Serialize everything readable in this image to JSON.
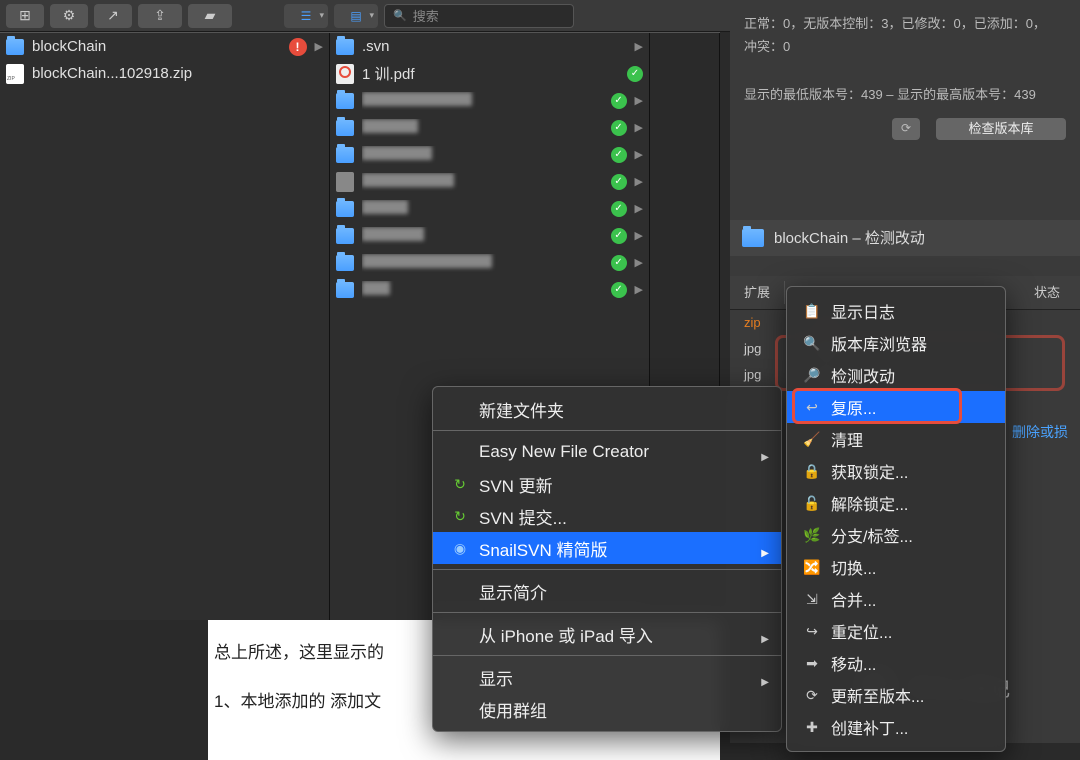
{
  "toolbar": {
    "search_placeholder": "搜索"
  },
  "col1": {
    "items": [
      {
        "type": "folder",
        "name": "blockChain",
        "alert": true,
        "chev": true
      },
      {
        "type": "zip",
        "name": "blockChain...102918.zip"
      }
    ]
  },
  "col2": {
    "items": [
      {
        "type": "folder",
        "name": ".svn",
        "chev": true
      },
      {
        "type": "pdf",
        "name": "1                      训.pdf",
        "green": true,
        "blurw": 88
      },
      {
        "type": "folder",
        "blurw": 110,
        "green": true,
        "chev": true
      },
      {
        "type": "folder",
        "blurw": 56,
        "green": true,
        "chev": true
      },
      {
        "type": "folder",
        "blurw": 70,
        "green": true,
        "chev": true
      },
      {
        "type": "file",
        "blurw": 92,
        "green": true,
        "chev": true
      },
      {
        "type": "folder",
        "blurw": 46,
        "green": true,
        "chev": true
      },
      {
        "type": "folder",
        "blurw": 62,
        "green": true,
        "chev": true
      },
      {
        "type": "folder",
        "blurw": 130,
        "green": true,
        "chev": true
      },
      {
        "type": "folder",
        "blurw": 28,
        "green": true,
        "chev": true
      }
    ]
  },
  "info": {
    "stats_line1": "正常：0，无版本控制：3，已修改：0，已添加：0，",
    "stats_line2": "冲突：0",
    "rev_line": "显示的最低版本号：439 – 显示的最高版本号：439",
    "reload_label": "⟳",
    "check_btn": "检查版本库",
    "hdr_title": "blockChain – 检测改动",
    "col_ext": "扩展",
    "col_state": "状态",
    "rows": [
      {
        "ext": "zip",
        "orange": true
      },
      {
        "ext": "jpg"
      },
      {
        "ext": "jpg"
      }
    ],
    "link": "删除或损"
  },
  "article": {
    "p1": "总上所述，这里显示的",
    "p2": "1、本地添加的 添加文"
  },
  "menu1": {
    "items": [
      {
        "label": "新建文件夹"
      },
      {
        "sep": true
      },
      {
        "label": "Easy New File Creator",
        "sub": true
      },
      {
        "icon": "↻",
        "iconColor": "#6c3",
        "label": "SVN 更新"
      },
      {
        "icon": "↻",
        "iconColor": "#6c3",
        "label": "SVN 提交..."
      },
      {
        "icon": "◉",
        "iconColor": "#9cf",
        "label": "SnailSVN 精简版",
        "sub": true,
        "hl": true
      },
      {
        "sep": true
      },
      {
        "label": "显示简介"
      },
      {
        "sep": true
      },
      {
        "label": "从 iPhone 或 iPad 导入",
        "sub": true
      },
      {
        "sep": true
      },
      {
        "label": "显示",
        "sub": true
      },
      {
        "label": "使用群组"
      }
    ]
  },
  "menu2": {
    "items": [
      {
        "icon": "📋",
        "label": "显示日志"
      },
      {
        "icon": "🔍",
        "label": "版本库浏览器"
      },
      {
        "icon": "🔎",
        "label": "检测改动"
      },
      {
        "icon": "↩",
        "label": "复原...",
        "hl": true
      },
      {
        "icon": "🧹",
        "label": "清理"
      },
      {
        "icon": "🔒",
        "label": "获取锁定..."
      },
      {
        "icon": "🔓",
        "label": "解除锁定..."
      },
      {
        "icon": "🌿",
        "label": "分支/标签..."
      },
      {
        "icon": "🔀",
        "label": "切换..."
      },
      {
        "icon": "⇲",
        "label": "合并..."
      },
      {
        "icon": "↪",
        "label": "重定位..."
      },
      {
        "icon": "➡",
        "label": "移动..."
      },
      {
        "icon": "⟳",
        "label": "更新至版本..."
      },
      {
        "icon": "✚",
        "label": "创建补丁..."
      }
    ]
  },
  "watermark": "平凡人笔记"
}
